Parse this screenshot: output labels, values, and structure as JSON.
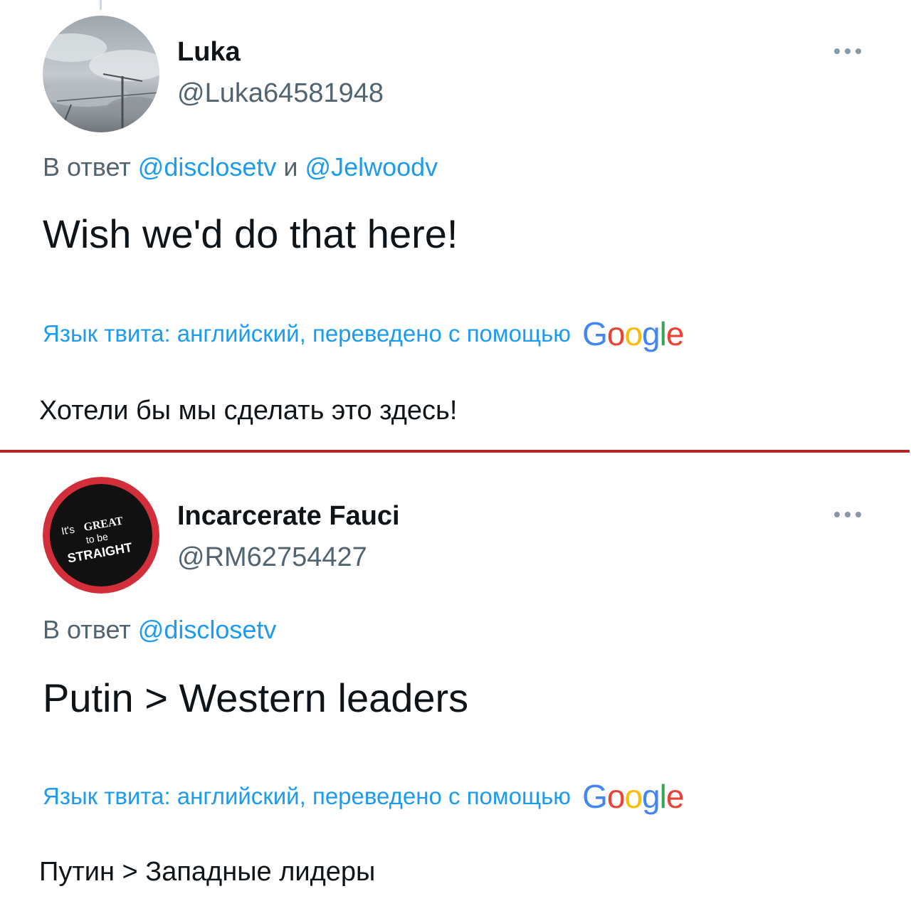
{
  "tweets": [
    {
      "display_name": "Luka",
      "handle": "@Luka64581948",
      "avatar_icon": "cloudy-sky-avatar",
      "reply_prefix": "В ответ",
      "reply_to_1": "@disclosetv",
      "reply_conj": "и",
      "reply_to_2": "@Jelwoodv",
      "text": "Wish we'd do that here!",
      "translation_label": "Язык твита: английский, переведено с помощью",
      "translated_text": "Хотели бы мы сделать это здесь!"
    },
    {
      "display_name": "Incarcerate Fauci",
      "handle": "@RM62754427",
      "avatar_icon": "its-great-to-be-straight-avatar",
      "avatar_text": [
        "It's",
        "GREAT",
        "to be",
        "STRAIGHT"
      ],
      "reply_prefix": "В ответ",
      "reply_to_1": "@disclosetv",
      "text": "Putin > Western leaders",
      "translation_label": "Язык твита: английский, переведено с помощью",
      "translated_text": "Путин > Западные лидеры"
    }
  ],
  "google_logo": {
    "letters": [
      "G",
      "o",
      "o",
      "g",
      "l",
      "e"
    ],
    "colors": [
      "#4285F4",
      "#EA4335",
      "#FBBC05",
      "#4285F4",
      "#34A853",
      "#EA4335"
    ]
  },
  "colors": {
    "link": "#1d9bf0",
    "secondary_text": "#536471",
    "separator": "#b32626"
  }
}
